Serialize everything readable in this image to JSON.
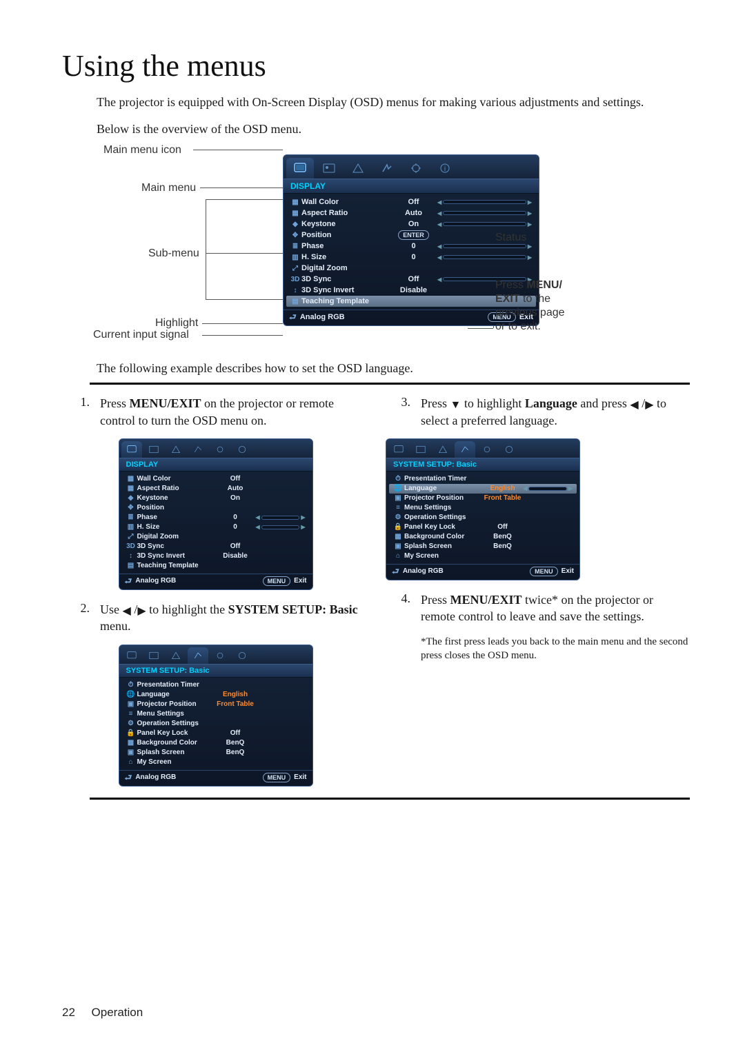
{
  "title": "Using the menus",
  "intro1": "The projector is equipped with On-Screen Display (OSD) menus for making various adjustments and settings.",
  "intro2": "Below is the overview of the OSD menu.",
  "callouts": {
    "main_menu_icon": "Main menu icon",
    "main_menu": "Main menu",
    "sub_menu": "Sub-menu",
    "highlight": "Highlight",
    "current_input": "Current input signal",
    "status": "Status",
    "press_menu_exit": "Press MENU/ EXIT to the previous page or to exit.",
    "press_menu_exit_prefix": "Press ",
    "press_menu_exit_bold": "MENU/ EXIT",
    "press_menu_exit_rest": " to the previous page or to exit."
  },
  "osd": {
    "heading_display": "DISPLAY",
    "heading_system": "SYSTEM SETUP: Basic",
    "enter": "ENTER",
    "menu": "MENU",
    "exit": "Exit",
    "input": "Analog RGB",
    "display_items": [
      {
        "label": "Wall Color",
        "value": "Off",
        "slider": true
      },
      {
        "label": "Aspect Ratio",
        "value": "Auto",
        "slider": true
      },
      {
        "label": "Keystone",
        "value": "On",
        "slider": true
      },
      {
        "label": "Position",
        "enter": true
      },
      {
        "label": "Phase",
        "value": "0",
        "slider": true
      },
      {
        "label": "H. Size",
        "value": "0",
        "slider": true
      },
      {
        "label": "Digital Zoom"
      },
      {
        "label": "3D Sync",
        "value": "Off",
        "slider": true
      },
      {
        "label": "3D Sync Invert",
        "value": "Disable"
      },
      {
        "label": "Teaching Template"
      }
    ],
    "system_items": [
      {
        "label": "Presentation Timer"
      },
      {
        "label": "Language",
        "value": "English",
        "orange": true,
        "slider": true
      },
      {
        "label": "Projector Position",
        "value": "Front Table",
        "orange": true
      },
      {
        "label": "Menu Settings"
      },
      {
        "label": "Operation Settings"
      },
      {
        "label": "Panel Key Lock",
        "value": "Off"
      },
      {
        "label": "Background Color",
        "value": "BenQ"
      },
      {
        "label": "Splash Screen",
        "value": "BenQ"
      },
      {
        "label": "My Screen"
      }
    ]
  },
  "desc_following": "The following example describes how to set the OSD language.",
  "steps": {
    "s1_num": "1.",
    "s1_a": "Press ",
    "s1_b": "MENU/EXIT",
    "s1_c": " on the projector or remote control to turn the OSD menu on.",
    "s2_num": "2.",
    "s2_a": "Use ",
    "s2_b": " to highlight the ",
    "s2_c": "SYSTEM SETUP: Basic",
    "s2_d": " menu.",
    "s3_num": "3.",
    "s3_a": "Press ",
    "s3_b": " to highlight ",
    "s3_c": "Language",
    "s3_d": " and press ",
    "s3_e": " to select a preferred language.",
    "s4_num": "4.",
    "s4_a": "Press ",
    "s4_b": "MENU/EXIT",
    "s4_c": " twice* on the projector or remote control to leave and save the settings."
  },
  "footnote": "*The first press leads you back to the main menu and the second press closes the OSD menu.",
  "page_number": "22",
  "page_section": "Operation"
}
